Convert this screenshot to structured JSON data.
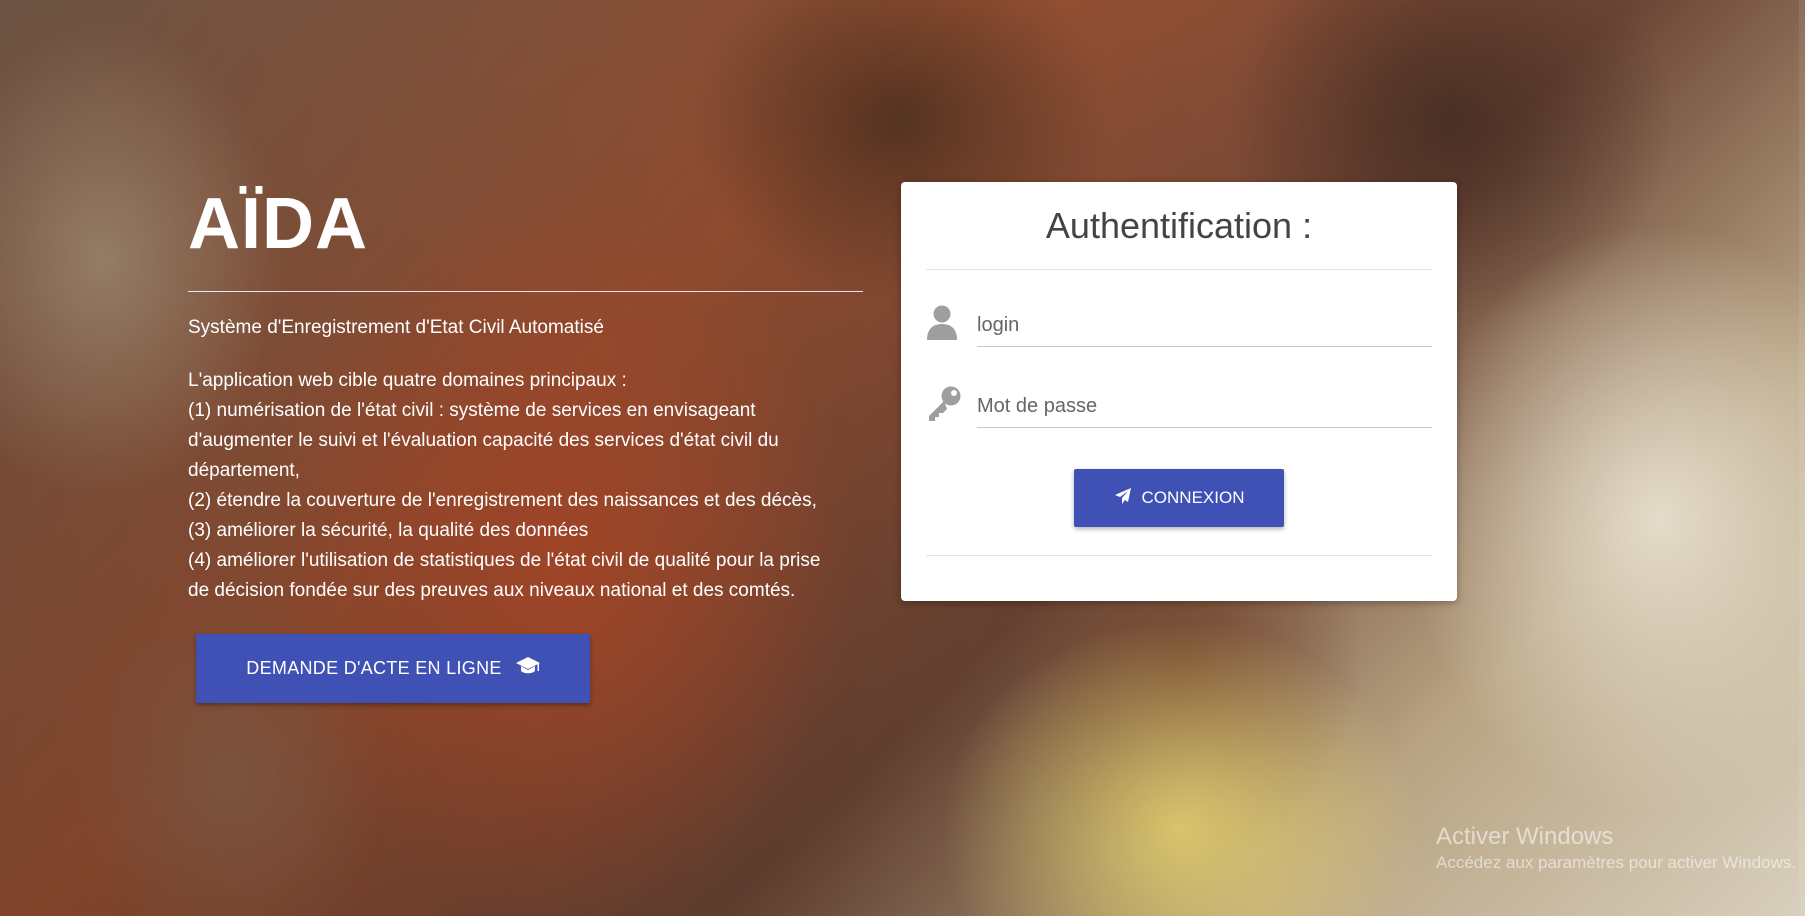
{
  "intro": {
    "brand": "AÏDA",
    "subtitle": "Système d'Enregistrement d'Etat Civil Automatisé",
    "description_lines": [
      "L'application web cible quatre domaines principaux :",
      "(1) numérisation de l'état civil : système de services en envisageant",
      "d'augmenter le suivi et l'évaluation capacité des services d'état civil du",
      "département,",
      "(2) étendre la couverture de l'enregistrement des naissances et des décès,",
      "(3) améliorer la sécurité, la qualité des données",
      "(4) améliorer l'utilisation de statistiques de l'état civil de qualité pour la prise",
      "de décision fondée sur des preuves aux niveaux national et des comtés."
    ],
    "cta_label": "DEMANDE D'ACTE EN LIGNE",
    "cta_icon": "graduation-cap-icon"
  },
  "login": {
    "title": "Authentification :",
    "login_placeholder": "login",
    "login_icon": "user-icon",
    "password_placeholder": "Mot de passe",
    "password_icon": "key-icon",
    "submit_label": "CONNEXION",
    "submit_icon": "paper-plane-icon"
  },
  "watermark": {
    "title": "Activer Windows",
    "subtitle": "Accédez aux paramètres pour activer Windows."
  },
  "colors": {
    "primary": "#3f51b5",
    "card_background": "#ffffff",
    "title_text": "#444444"
  }
}
